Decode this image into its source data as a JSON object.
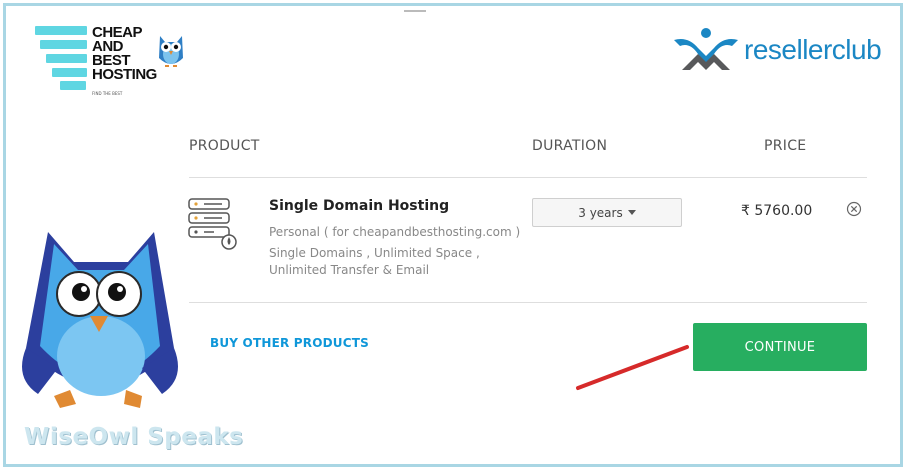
{
  "brand_left": {
    "lines": [
      "CHEAP",
      "AND",
      "BEST",
      "HOSTING"
    ],
    "tagline": "FIND THE BEST"
  },
  "brand_right": {
    "name": "resellerclub"
  },
  "table": {
    "headers": {
      "product": "PRODUCT",
      "duration": "DURATION",
      "price": "PRICE"
    }
  },
  "item": {
    "name": "Single Domain Hosting",
    "plan": "Personal ( for cheapandbesthosting.com )",
    "description": "Single Domains , Unlimited Space , Unlimited Transfer & Email",
    "duration": "3 years",
    "price": "₹ 5760.00"
  },
  "actions": {
    "buy_other": "BUY OTHER PRODUCTS",
    "continue": "CONTINUE"
  },
  "watermark": {
    "text": "WiseOwl Speaks"
  },
  "colors": {
    "frame": "#a9d6e4",
    "accent_blue": "#0f97d9",
    "continue_green": "#27ae60",
    "brand_teal": "#5fd6e2",
    "reseller_blue": "#1b87c4",
    "annotation_red": "#d62a2a"
  },
  "icons": [
    "owl-logo-icon",
    "server-icon",
    "close-circle-icon",
    "caret-down-icon",
    "annotation-arrow"
  ]
}
